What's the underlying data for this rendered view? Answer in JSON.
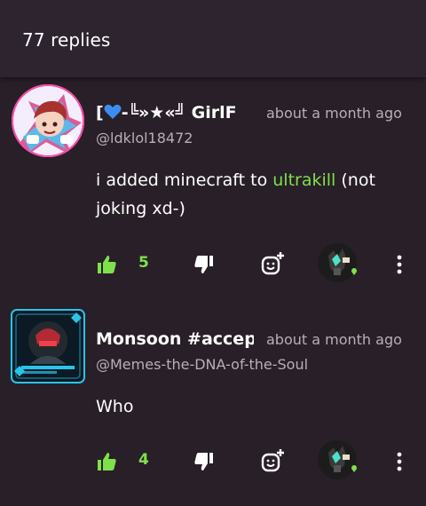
{
  "header": {
    "title": "77 replies"
  },
  "colors": {
    "background": "#291f28",
    "header_bg": "#2e2430",
    "accent_green": "#7fe04b",
    "muted_text": "#b9aeb7"
  },
  "comments": [
    {
      "author_prefix": "[",
      "author_suffix": "-╚»★«╝ GirlF",
      "time": "about a month ago",
      "handle": "@ldklol18472",
      "text_before": "i added minecraft to ",
      "link": "ultrakill",
      "text_after": " (not joking xd-)",
      "likes": "5",
      "icons": [
        "avatar-image",
        "heart-icon",
        "thumbs-up-icon",
        "thumbs-down-icon",
        "add-comment-icon",
        "more-vert-icon"
      ]
    },
    {
      "author": "Monsoon #accep",
      "time": "about a month ago",
      "handle": "@Memes-the-DNA-of-the-Soul",
      "text": "Who",
      "likes": "4",
      "icons": [
        "avatar-image",
        "thumbs-up-icon",
        "thumbs-down-icon",
        "add-comment-icon",
        "more-vert-icon"
      ]
    }
  ]
}
